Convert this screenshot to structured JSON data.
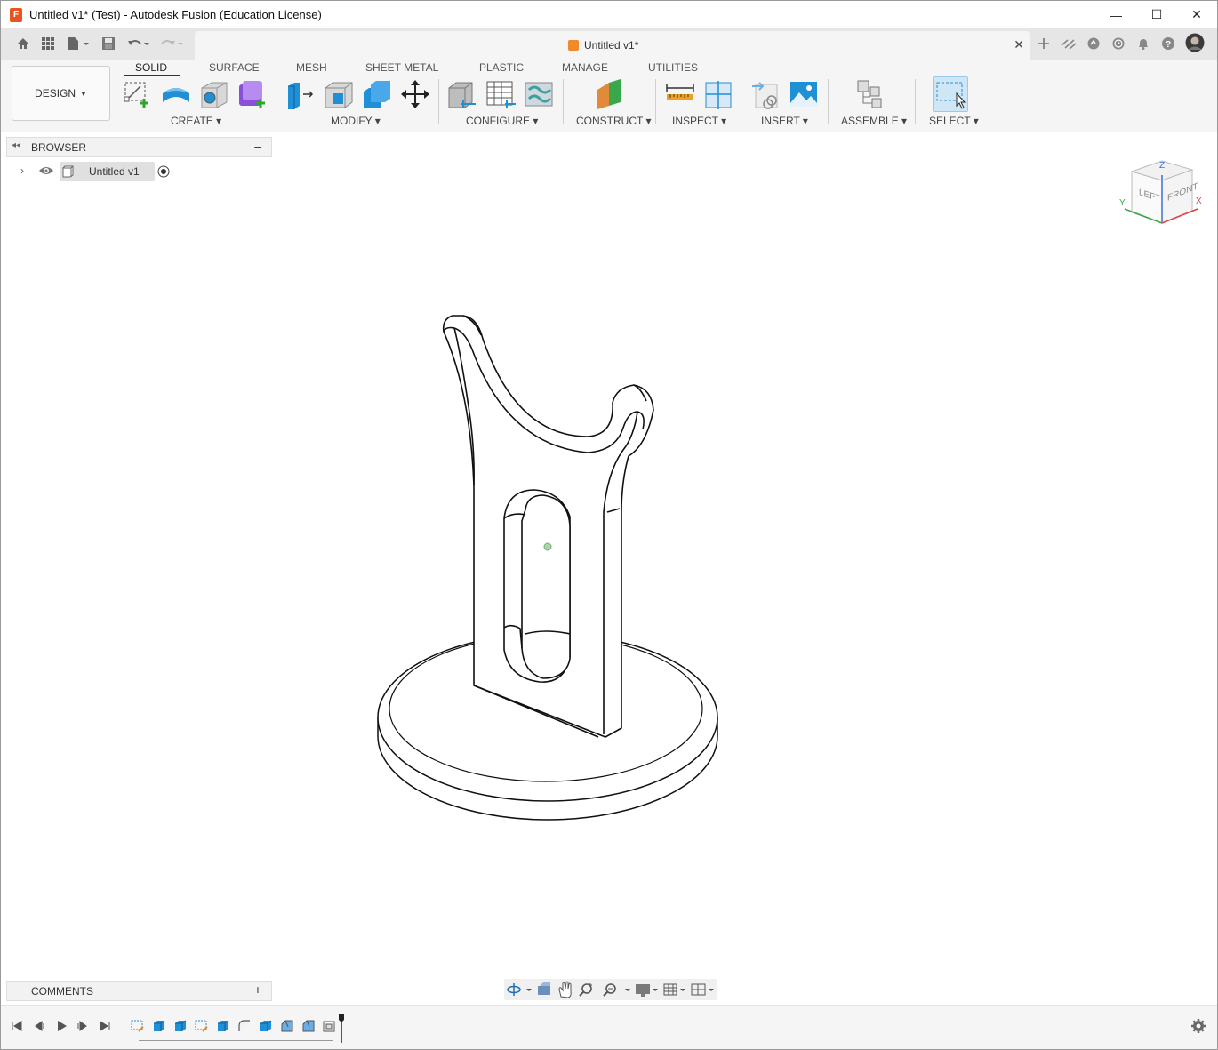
{
  "window": {
    "title": "Untitled v1* (Test) - Autodesk Fusion (Education License)",
    "app_icon_letter": "F",
    "controls": {
      "minimize": "—",
      "maximize": "☐",
      "close": "✕"
    }
  },
  "doc_tab": {
    "label": "Untitled v1*",
    "close": "✕"
  },
  "toolbar": {
    "workspace": "DESIGN",
    "tabs": [
      "SOLID",
      "SURFACE",
      "MESH",
      "SHEET METAL",
      "PLASTIC",
      "MANAGE",
      "UTILITIES"
    ],
    "active_tab": "SOLID",
    "groups": [
      "CREATE",
      "MODIFY",
      "CONFIGURE",
      "CONSTRUCT",
      "INSPECT",
      "INSERT",
      "ASSEMBLE",
      "SELECT"
    ]
  },
  "browser": {
    "header": "BROWSER",
    "collapse": "–",
    "root_label": "Untitled v1"
  },
  "comments": {
    "header": "COMMENTS",
    "add": "+"
  },
  "viewcube": {
    "left": "LEFT",
    "front": "FRONT",
    "z": "Z",
    "x": "X",
    "y": "Y"
  },
  "colors": {
    "accent_blue": "#1f8fd6",
    "orange": "#f08a2a",
    "green_plus": "#2aa62a",
    "purple": "#8a4fd8",
    "select_blue": "#cfe6f7"
  }
}
